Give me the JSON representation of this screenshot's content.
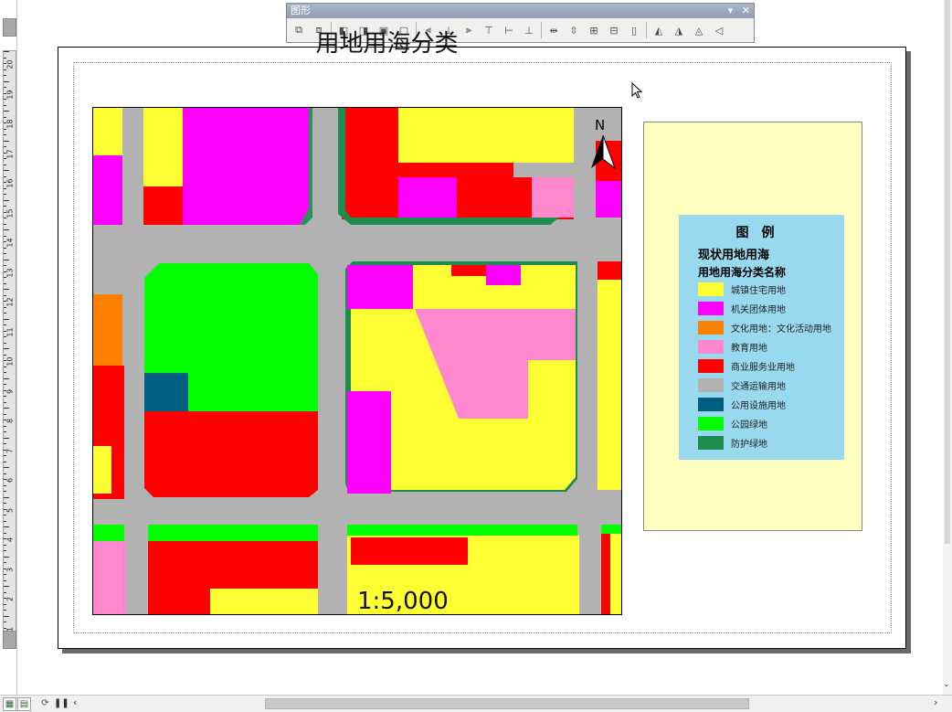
{
  "toolbar": {
    "title": "图形",
    "dropdown": "▾",
    "close": "✕",
    "icons": [
      "group-icon",
      "ungroup-icon",
      "sep",
      "bring-to-front-icon",
      "send-to-back-icon",
      "bring-forward-icon",
      "send-backward-icon",
      "sep",
      "align-left-icon",
      "align-center-icon",
      "align-right-icon",
      "align-top-icon",
      "align-middle-icon",
      "align-bottom-icon",
      "sep",
      "distribute-horizontal-icon",
      "distribute-vertical-icon",
      "make-same-size-icon",
      "make-same-width-icon",
      "make-same-height-icon",
      "sep",
      "rotate-left-icon",
      "rotate-right-icon",
      "flip-horizontal-icon",
      "flip-vertical-icon"
    ]
  },
  "map": {
    "title": "用地用海分类",
    "scale": "1:5,000",
    "north": "N"
  },
  "legend": {
    "title": "图例",
    "heading1": "现状用地用海",
    "heading2": "用地用海分类名称",
    "items": [
      {
        "label": "城镇住宅用地",
        "color": "#ffff33"
      },
      {
        "label": "机关团体用地",
        "color": "#ff00ff"
      },
      {
        "label": "文化用地：文化活动用地",
        "color": "#ff7f00"
      },
      {
        "label": "教育用地",
        "color": "#ff88cc"
      },
      {
        "label": "商业服务业用地",
        "color": "#ff0000"
      },
      {
        "label": "交通运输用地",
        "color": "#b2b2b2"
      },
      {
        "label": "公用设施用地",
        "color": "#005f80"
      },
      {
        "label": "公园绿地",
        "color": "#00ff00"
      },
      {
        "label": "防护绿地",
        "color": "#1e8c4e"
      }
    ]
  },
  "ruler": {
    "labels": [
      "20",
      "19",
      "18",
      "17",
      "16",
      "15",
      "14",
      "13",
      "12",
      "11",
      "10",
      "9",
      "8",
      "7",
      "6",
      "5",
      "4",
      "3",
      "2",
      "1"
    ]
  },
  "statusbar": {
    "left_arrow": "‹",
    "right_arrow": "›"
  }
}
